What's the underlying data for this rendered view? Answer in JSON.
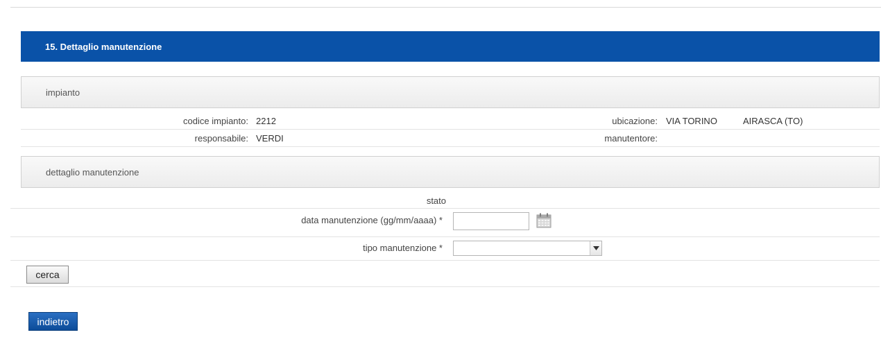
{
  "page": {
    "title": "15. Dettaglio manutenzione"
  },
  "impianto": {
    "section_label": "impianto",
    "codice_label": "codice impianto:",
    "codice_value": "2212",
    "ubicazione_label": "ubicazione:",
    "ubicazione_street": "VIA TORINO",
    "ubicazione_city": "AIRASCA (TO)",
    "responsabile_label": "responsabile:",
    "responsabile_value": "VERDI",
    "manutentore_label": "manutentore:",
    "manutentore_value": ""
  },
  "dettaglio": {
    "section_label": "dettaglio manutenzione",
    "stato_label": "stato",
    "data_label": "data manutenzione (gg/mm/aaaa) *",
    "data_value": "",
    "tipo_label": "tipo manutenzione *",
    "tipo_selected": ""
  },
  "actions": {
    "search_label": "cerca",
    "back_label": "indietro"
  },
  "colors": {
    "title_bar": "#0a52a8",
    "back_button": "#0c4c99"
  },
  "icons": {
    "calendar": "calendar-icon",
    "dropdown": "chevron-down-icon"
  }
}
